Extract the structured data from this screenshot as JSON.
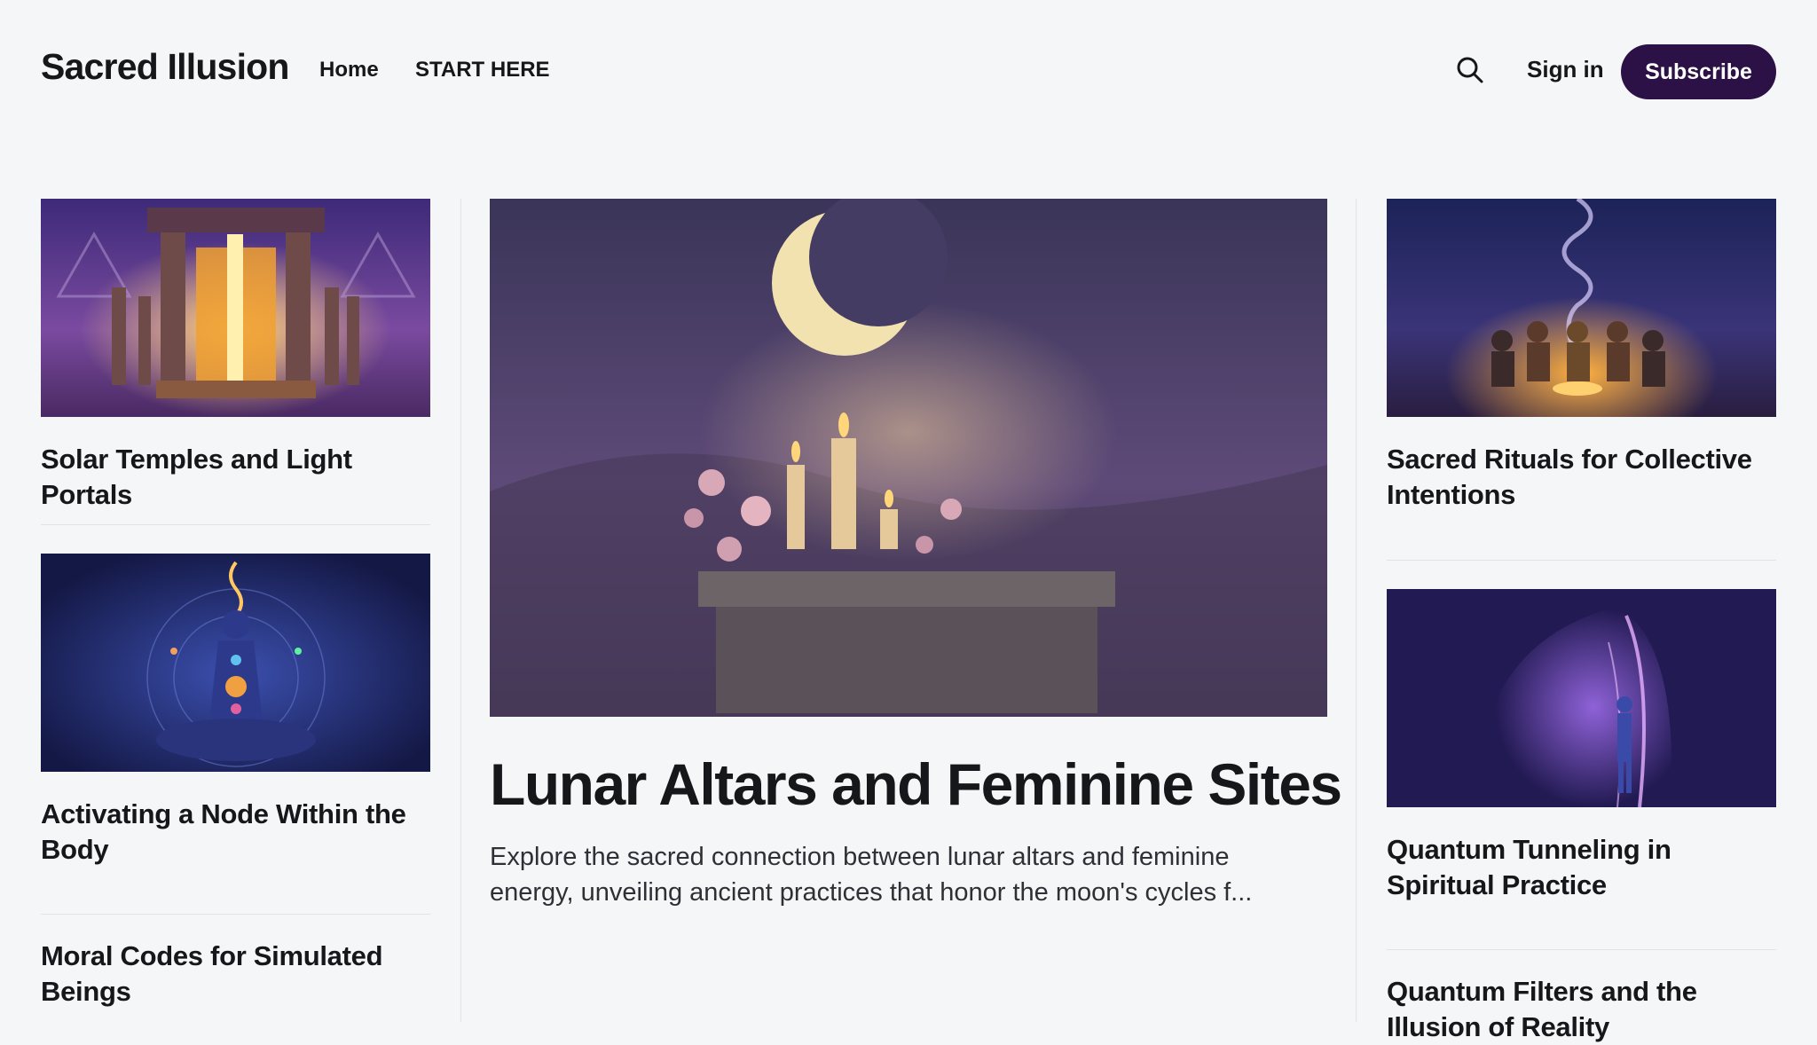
{
  "site": {
    "title": "Sacred Illusion"
  },
  "nav": {
    "items": [
      {
        "label": "Home"
      },
      {
        "label": "START HERE"
      }
    ]
  },
  "header": {
    "signin_label": "Sign in",
    "subscribe_label": "Subscribe",
    "search_icon": "search-icon"
  },
  "colors": {
    "accent": "#2b1145",
    "background": "#f5f6f8",
    "text": "#15171a"
  },
  "left_column": {
    "posts": [
      {
        "title": "Solar Temples and Light Portals"
      },
      {
        "title": "Activating a Node Within the Body"
      },
      {
        "title": "Moral Codes for Simulated Beings"
      }
    ]
  },
  "featured": {
    "title": "Lunar Altars and Feminine Sites",
    "excerpt": "Explore the sacred connection between lunar altars and feminine energy, unveiling ancient practices that honor the moon's cycles f..."
  },
  "right_column": {
    "posts": [
      {
        "title": "Sacred Rituals for Collective Intentions"
      },
      {
        "title": "Quantum Tunneling in Spiritual Practice"
      },
      {
        "title": "Quantum Filters and the Illusion of Reality"
      }
    ]
  }
}
